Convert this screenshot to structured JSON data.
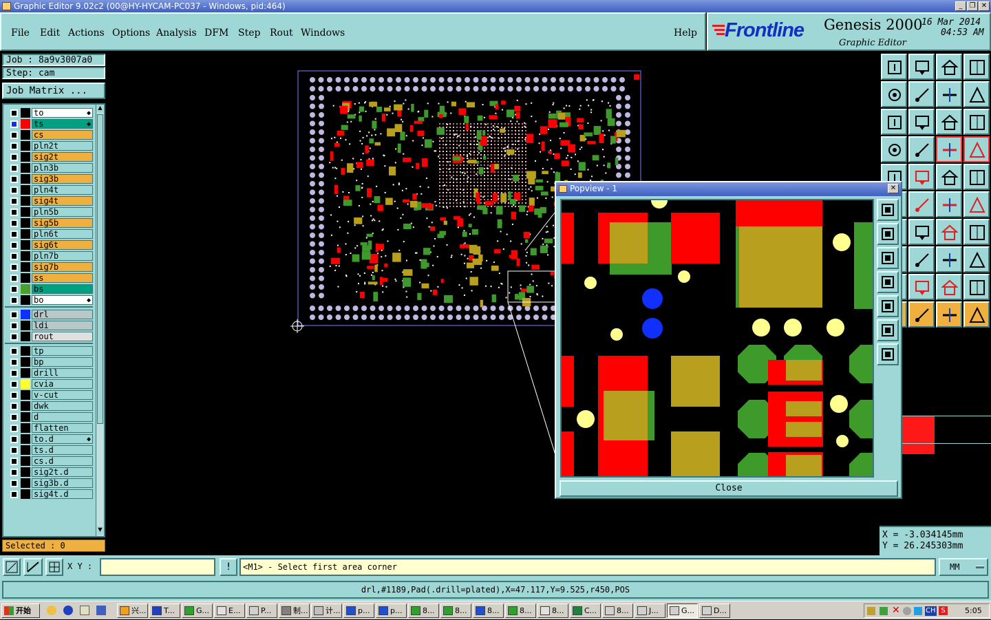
{
  "window": {
    "title": "Graphic Editor 9.02c2 (00@HY-HYCAM-PC037 - Windows, pid:464)"
  },
  "menu": {
    "file": "File",
    "edit": "Edit",
    "actions": "Actions",
    "options": "Options",
    "analysis": "Analysis",
    "dfm": "DFM",
    "step": "Step",
    "rout": "Rout",
    "windows": "Windows",
    "help": "Help"
  },
  "brand": {
    "logo": "Frontline",
    "product": "Genesis 2000",
    "subtitle": "Graphic Editor",
    "date": "16 Mar 2014",
    "time": "04:53 AM"
  },
  "job": {
    "job_label": "Job : 8a9v3007a0",
    "step_label": "Step: cam",
    "matrix_button": "Job Matrix ..."
  },
  "layers": [
    {
      "name": "to",
      "bg": "#ffffff",
      "swatch": "#000000",
      "mark": true
    },
    {
      "name": "ts",
      "bg": "#00a080",
      "swatch": "#ff0000",
      "mark": true,
      "active": true
    },
    {
      "name": "cs",
      "bg": "#f0b040",
      "swatch": "#000000"
    },
    {
      "name": "pln2t",
      "bg": "#9fd6d6",
      "swatch": "#000000"
    },
    {
      "name": "sig2t",
      "bg": "#f0b040",
      "swatch": "#000000"
    },
    {
      "name": "pln3b",
      "bg": "#9fd6d6",
      "swatch": "#000000"
    },
    {
      "name": "sig3b",
      "bg": "#f0b040",
      "swatch": "#000000"
    },
    {
      "name": "pln4t",
      "bg": "#9fd6d6",
      "swatch": "#000000"
    },
    {
      "name": "sig4t",
      "bg": "#f0b040",
      "swatch": "#000000"
    },
    {
      "name": "pln5b",
      "bg": "#9fd6d6",
      "swatch": "#000000"
    },
    {
      "name": "sig5b",
      "bg": "#f0b040",
      "swatch": "#000000"
    },
    {
      "name": "pln6t",
      "bg": "#9fd6d6",
      "swatch": "#000000"
    },
    {
      "name": "sig6t",
      "bg": "#f0b040",
      "swatch": "#000000"
    },
    {
      "name": "pln7b",
      "bg": "#9fd6d6",
      "swatch": "#000000"
    },
    {
      "name": "sig7b",
      "bg": "#f0b040",
      "swatch": "#000000"
    },
    {
      "name": "ss",
      "bg": "#f0b040",
      "swatch": "#000000"
    },
    {
      "name": "bs",
      "bg": "#00a080",
      "swatch": "#4aa02a"
    },
    {
      "name": "bo",
      "bg": "#ffffff",
      "swatch": "#000000",
      "mark": true
    }
  ],
  "drill_layers": [
    {
      "name": "drl",
      "bg": "#b8c8c8",
      "swatch": "#1030ff"
    },
    {
      "name": "ldi",
      "bg": "#b8c8c8",
      "swatch": "#000000"
    },
    {
      "name": "rout",
      "bg": "#e0e0e0",
      "swatch": "#000000"
    }
  ],
  "misc_layers": [
    {
      "name": "tp",
      "bg": "#9fd6d6",
      "swatch": "#000000"
    },
    {
      "name": "bp",
      "bg": "#9fd6d6",
      "swatch": "#000000"
    },
    {
      "name": "drill",
      "bg": "#9fd6d6",
      "swatch": "#000000"
    },
    {
      "name": "cvia",
      "bg": "#9fd6d6",
      "swatch": "#ffff30"
    },
    {
      "name": "v-cut",
      "bg": "#9fd6d6",
      "swatch": "#000000"
    },
    {
      "name": "dwk",
      "bg": "#9fd6d6",
      "swatch": "#000000"
    },
    {
      "name": "d",
      "bg": "#9fd6d6",
      "swatch": "#000000"
    },
    {
      "name": "flatten",
      "bg": "#9fd6d6",
      "swatch": "#000000"
    },
    {
      "name": "to.d",
      "bg": "#9fd6d6",
      "swatch": "#000000",
      "mark": true
    },
    {
      "name": "ts.d",
      "bg": "#9fd6d6",
      "swatch": "#000000"
    },
    {
      "name": "cs.d",
      "bg": "#9fd6d6",
      "swatch": "#000000"
    },
    {
      "name": "sig2t.d",
      "bg": "#9fd6d6",
      "swatch": "#000000"
    },
    {
      "name": "sig3b.d",
      "bg": "#9fd6d6",
      "swatch": "#000000"
    },
    {
      "name": "sig4t.d",
      "bg": "#9fd6d6",
      "swatch": "#000000"
    }
  ],
  "selected": "Selected : 0",
  "popview": {
    "title": "Popview - 1",
    "close": "Close"
  },
  "coords": {
    "x": "X = -3.034145mm",
    "y": "Y = 26.245303mm"
  },
  "command": {
    "xy_label": "X Y :",
    "xy_value": "",
    "prompt": "<M1> - Select first area corner",
    "units": "MM"
  },
  "status": "drl,#1189,Pad(.drill=plated),X=47.117,Y=9.525,r450,POS",
  "taskbar": {
    "start": "开始",
    "tasks": [
      "兴...",
      "T...",
      "G...",
      "E...",
      "P...",
      "制...",
      "计...",
      "p...",
      "p...",
      "8...",
      "8...",
      "8...",
      "8...",
      "8...",
      "C...",
      "8...",
      "J...",
      "G...",
      "D..."
    ],
    "tray_ch": "CH",
    "clock": "5:05"
  },
  "colors": {
    "teal": "#9fd6d6",
    "pad_red": "#ff0000",
    "pad_green": "#3e9a2a",
    "pad_olive": "#b8a01e",
    "drill_blue": "#1030ff",
    "via_yellow": "#ffff90"
  }
}
